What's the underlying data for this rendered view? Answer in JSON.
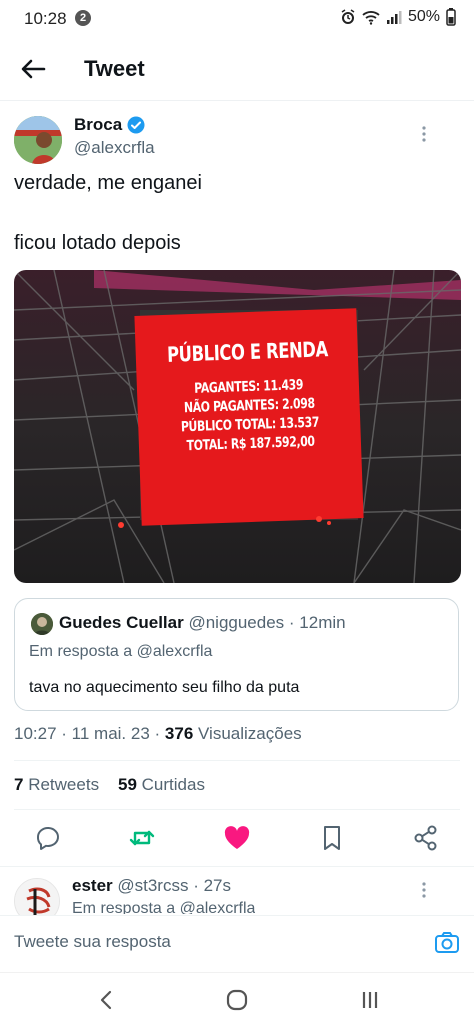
{
  "status_bar": {
    "time": "10:28",
    "notification_count": "2",
    "battery": "50%"
  },
  "header": {
    "title": "Tweet"
  },
  "tweet": {
    "author_name": "Broca",
    "author_handle": "@alexcrfla",
    "text_line1": "verdade, me enganei",
    "text_line2": "ficou lotado depois",
    "image": {
      "screen_title": "PÚBLICO E RENDA",
      "line1": "PAGANTES: 11.439",
      "line2": "NÃO PAGANTES: 2.098",
      "line3": "PÚBLICO TOTAL: 13.537",
      "line4": "TOTAL: R$ 187.592,00"
    },
    "quote": {
      "name": "Guedes Cuellar",
      "handle": "@nigguedes",
      "time": "· 12min",
      "reply_to": "Em resposta a @alexcrfla",
      "text": "tava no aquecimento seu filho da puta"
    },
    "time": "10:27",
    "date": "· 11 mai. 23 ·",
    "views_count": "376",
    "views_label": "Visualizações",
    "retweets_count": "7",
    "retweets_label": "Retweets",
    "likes_count": "59",
    "likes_label": "Curtidas"
  },
  "reply": {
    "name": "ester",
    "handle": "@st3rcss",
    "time": "· 27s",
    "reply_to": "Em resposta a @alexcrfla"
  },
  "compose": {
    "placeholder": "Tweete sua resposta"
  },
  "colors": {
    "accent": "#1d9bf0",
    "like": "#f91880",
    "retweet": "#00ba7c",
    "screen_red": "#e5191c"
  }
}
